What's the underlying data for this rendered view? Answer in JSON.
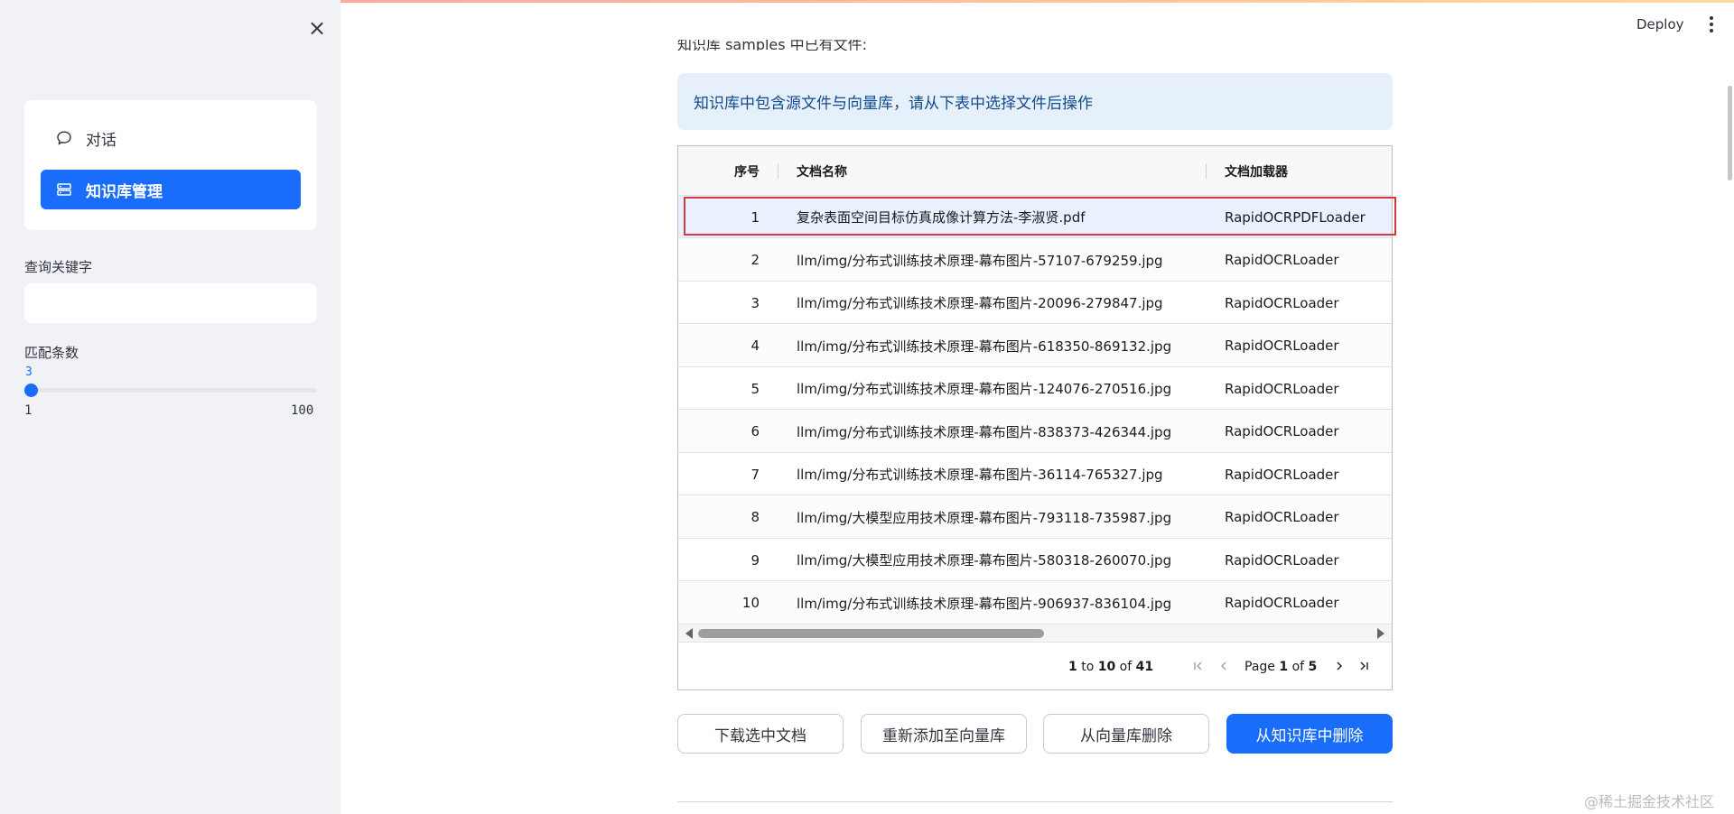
{
  "sidebar": {
    "close_icon": "×",
    "menu": [
      {
        "label": "对话",
        "icon": "chat-bubble-icon",
        "active": false
      },
      {
        "label": "知识库管理",
        "icon": "database-icon",
        "active": true
      }
    ],
    "search_label": "查询关键字",
    "search_value": "",
    "match_label": "匹配条数",
    "slider": {
      "value": "3",
      "min": "1",
      "max": "100",
      "fraction": 0
    }
  },
  "header": {
    "deploy_label": "Deploy",
    "menu_icon": "kebab-menu-icon"
  },
  "main": {
    "cut_text": "知识库 samples 中已有文件:",
    "info": "知识库中包含源文件与向量库，请从下表中选择文件后操作",
    "table": {
      "columns": [
        "序号",
        "文档名称",
        "文档加载器"
      ],
      "rows": [
        [
          "1",
          "复杂表面空间目标仿真成像计算方法-李淑贤.pdf",
          "RapidOCRPDFLoader"
        ],
        [
          "2",
          "llm/img/分布式训练技术原理-幕布图片-57107-679259.jpg",
          "RapidOCRLoader"
        ],
        [
          "3",
          "llm/img/分布式训练技术原理-幕布图片-20096-279847.jpg",
          "RapidOCRLoader"
        ],
        [
          "4",
          "llm/img/分布式训练技术原理-幕布图片-618350-869132.jpg",
          "RapidOCRLoader"
        ],
        [
          "5",
          "llm/img/分布式训练技术原理-幕布图片-124076-270516.jpg",
          "RapidOCRLoader"
        ],
        [
          "6",
          "llm/img/分布式训练技术原理-幕布图片-838373-426344.jpg",
          "RapidOCRLoader"
        ],
        [
          "7",
          "llm/img/分布式训练技术原理-幕布图片-36114-765327.jpg",
          "RapidOCRLoader"
        ],
        [
          "8",
          "llm/img/大模型应用技术原理-幕布图片-793118-735987.jpg",
          "RapidOCRLoader"
        ],
        [
          "9",
          "llm/img/大模型应用技术原理-幕布图片-580318-260070.jpg",
          "RapidOCRLoader"
        ],
        [
          "10",
          "llm/img/分布式训练技术原理-幕布图片-906937-836104.jpg",
          "RapidOCRLoader"
        ]
      ],
      "selected_row": 0
    },
    "pagination": {
      "from": "1",
      "to_word": "to",
      "to": "10",
      "of_word": "of",
      "total": "41",
      "page_word": "Page",
      "page": "1",
      "pages": "5"
    },
    "actions": [
      "下载选中文档",
      "重新添加至向量库",
      "从向量库删除",
      "从知识库中删除"
    ]
  },
  "watermark": "@稀土掘金技术社区"
}
